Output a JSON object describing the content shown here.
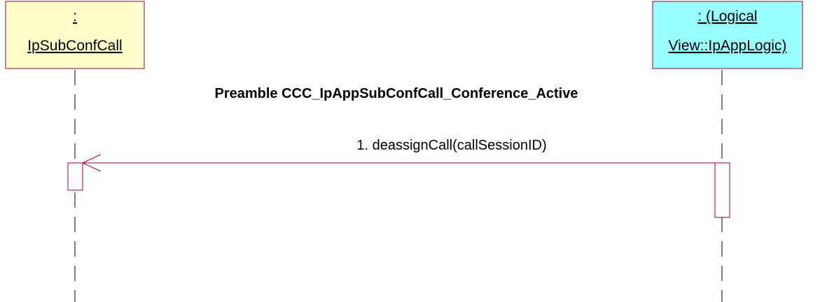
{
  "participants": [
    {
      "id": "ipsubconfcall",
      "line1": ":",
      "line2": "IpSubConfCall",
      "fill": "#FFFFCC"
    },
    {
      "id": "ipapplogic",
      "line1": ": (Logical",
      "line2": "View::IpAppLogic)",
      "fill": "#99FFFF"
    }
  ],
  "note": "Preamble CCC_IpAppSubConfCall_Conference_Active",
  "messages": [
    {
      "label": "1. deassignCall(callSessionID)"
    }
  ],
  "colors": {
    "box_border": "#990033",
    "lifeline": "#000000",
    "message": "#990033",
    "activation_border": "#990033",
    "text": "#000000"
  }
}
